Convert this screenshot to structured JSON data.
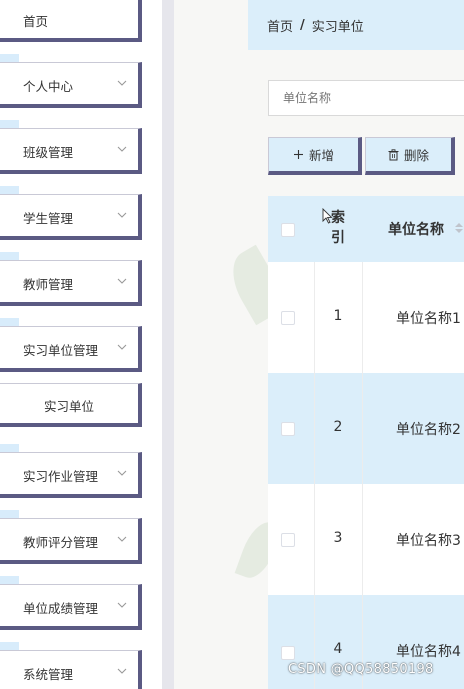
{
  "sidebar": {
    "items": [
      {
        "label": "首页",
        "has_chevron": false
      },
      {
        "label": "个人中心",
        "has_chevron": true
      },
      {
        "label": "班级管理",
        "has_chevron": true
      },
      {
        "label": "学生管理",
        "has_chevron": true
      },
      {
        "label": "教师管理",
        "has_chevron": true
      },
      {
        "label": "实习单位管理",
        "has_chevron": true
      },
      {
        "label": "实习作业管理",
        "has_chevron": true
      },
      {
        "label": "教师评分管理",
        "has_chevron": true
      },
      {
        "label": "单位成绩管理",
        "has_chevron": true
      },
      {
        "label": "系统管理",
        "has_chevron": true
      }
    ],
    "submenu": {
      "label": "实习单位"
    }
  },
  "breadcrumb": {
    "home": "首页",
    "separator": "/",
    "current": "实习单位"
  },
  "search": {
    "placeholder": "单位名称"
  },
  "toolbar": {
    "add_label": "新增",
    "delete_label": "删除"
  },
  "table": {
    "headers": {
      "index": "索\n引",
      "name": "单位名称"
    },
    "rows": [
      {
        "index": "1",
        "name": "单位名称1"
      },
      {
        "index": "2",
        "name": "单位名称2"
      },
      {
        "index": "3",
        "name": "单位名称3"
      },
      {
        "index": "4",
        "name": "单位名称4"
      }
    ]
  },
  "watermark": "CSDN @QQ58850198",
  "colors": {
    "accent_light": "#dbeefa",
    "accent_dark": "#5b5a83"
  },
  "icons": {
    "chevron": "chevron-down-icon",
    "plus": "plus-icon",
    "trash": "trash-icon",
    "sort": "sort-caret-icon"
  }
}
